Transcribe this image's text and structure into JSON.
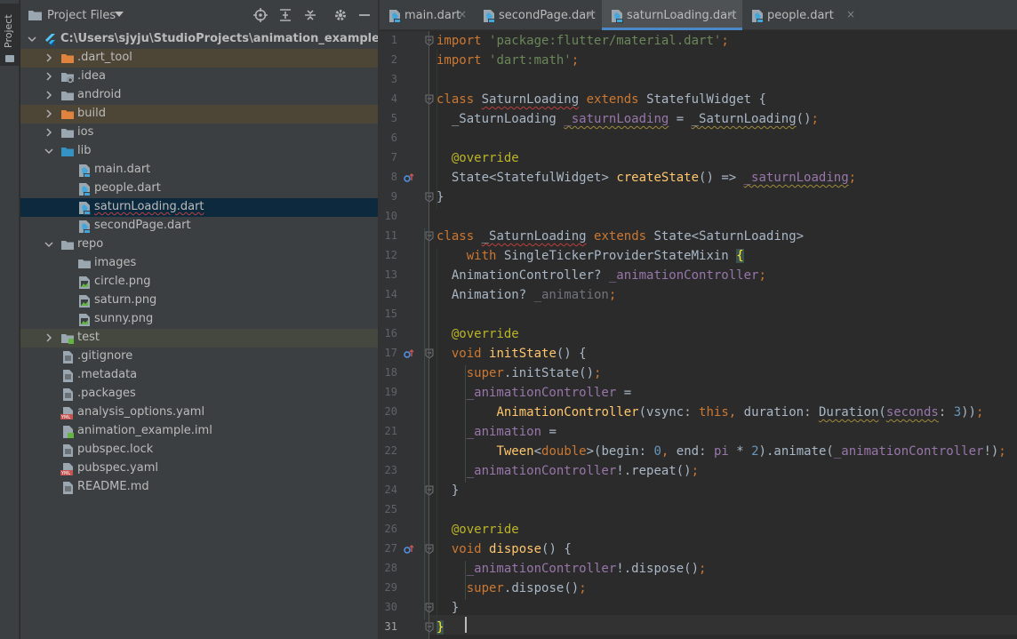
{
  "toolstripe": {
    "project_tab_label": "Project"
  },
  "panel": {
    "title": "Project Files",
    "tools": [
      "locate-icon",
      "expand-all-icon",
      "collapse-all-icon",
      "gear-icon",
      "hide-icon"
    ],
    "tree": [
      {
        "label": "C:\\Users\\sjyju\\StudioProjects\\animation_example",
        "icon": "flutter-icon",
        "depth": 0,
        "expanded": true,
        "bold": true
      },
      {
        "label": ".dart_tool",
        "icon": "folder-excluded-icon",
        "depth": 1,
        "expanded": false
      },
      {
        "label": ".idea",
        "icon": "folder-config-icon",
        "depth": 1,
        "expanded": false
      },
      {
        "label": "android",
        "icon": "folder-icon",
        "depth": 1,
        "expanded": false
      },
      {
        "label": "build",
        "icon": "folder-excluded-icon",
        "depth": 1,
        "expanded": false
      },
      {
        "label": "ios",
        "icon": "folder-icon",
        "depth": 1,
        "expanded": false
      },
      {
        "label": "lib",
        "icon": "folder-source-icon",
        "depth": 1,
        "expanded": true
      },
      {
        "label": "main.dart",
        "icon": "dart-file-icon",
        "depth": 2
      },
      {
        "label": "people.dart",
        "icon": "dart-file-icon",
        "depth": 2
      },
      {
        "label": "saturnLoading.dart",
        "icon": "dart-file-icon",
        "depth": 2,
        "selected": true
      },
      {
        "label": "secondPage.dart",
        "icon": "dart-file-icon",
        "depth": 2
      },
      {
        "label": "repo",
        "icon": "folder-icon",
        "depth": 1,
        "expanded": true
      },
      {
        "label": "images",
        "icon": "folder-icon",
        "depth": 2
      },
      {
        "label": "circle.png",
        "icon": "image-file-icon",
        "depth": 2
      },
      {
        "label": "saturn.png",
        "icon": "image-file-icon",
        "depth": 2
      },
      {
        "label": "sunny.png",
        "icon": "image-file-icon",
        "depth": 2
      },
      {
        "label": "test",
        "icon": "folder-test-icon",
        "depth": 1,
        "expanded": false
      },
      {
        "label": ".gitignore",
        "icon": "text-file-icon",
        "depth": 1
      },
      {
        "label": ".metadata",
        "icon": "text-file-icon",
        "depth": 1
      },
      {
        "label": ".packages",
        "icon": "text-file-icon",
        "depth": 1
      },
      {
        "label": "analysis_options.yaml",
        "icon": "yaml-file-icon",
        "depth": 1
      },
      {
        "label": "animation_example.iml",
        "icon": "iml-file-icon",
        "depth": 1
      },
      {
        "label": "pubspec.lock",
        "icon": "text-file-icon",
        "depth": 1
      },
      {
        "label": "pubspec.yaml",
        "icon": "yaml-file-icon",
        "depth": 1
      },
      {
        "label": "README.md",
        "icon": "text-file-icon",
        "depth": 1
      }
    ]
  },
  "tabs": [
    {
      "label": "main.dart",
      "icon": "dart-file-icon",
      "active": false
    },
    {
      "label": "secondPage.dart",
      "icon": "dart-file-icon",
      "active": false
    },
    {
      "label": "saturnLoading.dart",
      "icon": "dart-file-icon",
      "active": true
    },
    {
      "label": "people.dart",
      "icon": "dart-file-icon",
      "active": false
    }
  ],
  "tab_close_glyph": "×",
  "editor": {
    "current_line": 31,
    "lines": [
      "import 'package:flutter/material.dart';",
      "import 'dart:math';",
      "",
      "class SaturnLoading extends StatefulWidget {",
      "  _SaturnLoading _saturnLoading = _SaturnLoading();",
      "",
      "  @override",
      "  State<StatefulWidget> createState() => _saturnLoading;",
      "}",
      "",
      "class _SaturnLoading extends State<SaturnLoading>",
      "    with SingleTickerProviderStateMixin {",
      "  AnimationController? _animationController;",
      "  Animation? _animation;",
      "",
      "  @override",
      "  void initState() {",
      "    super.initState();",
      "    _animationController =",
      "        AnimationController(vsync: this, duration: Duration(seconds: 3));",
      "    _animation =",
      "        Tween<double>(begin: 0, end: pi * 2).animate(_animationController!);",
      "    _animationController!.repeat();",
      "  }",
      "",
      "  @override",
      "  void dispose() {",
      "    _animationController!.dispose();",
      "    super.dispose();",
      "  }",
      "}"
    ],
    "override_markers": [
      8,
      17,
      27
    ]
  },
  "colors": {
    "keyword": "#cc7832",
    "string": "#6a8759",
    "number": "#6897bb",
    "annotation": "#bbb529",
    "function": "#ffc66d",
    "field": "#9876aa",
    "selection": "#0d293e",
    "excluded_folder": "#4d4535",
    "test_folder": "#45483f"
  }
}
